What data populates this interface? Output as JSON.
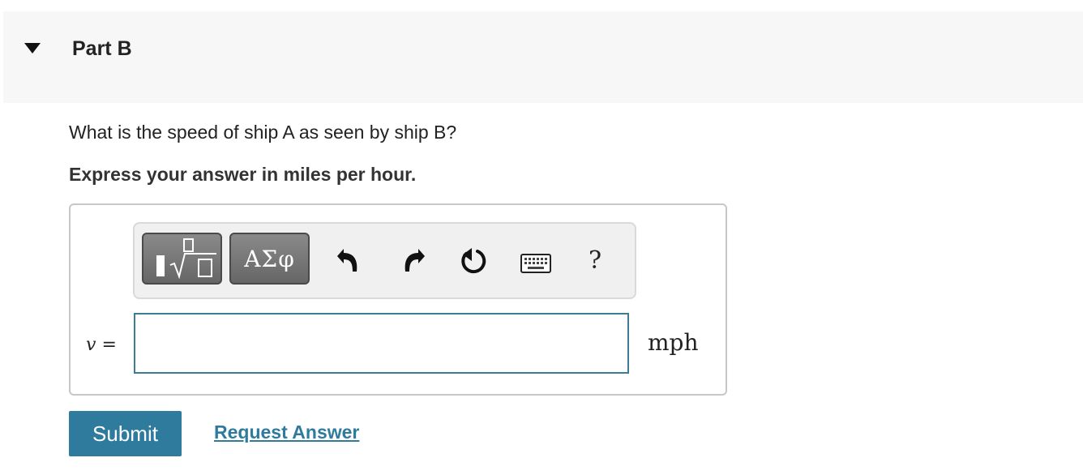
{
  "part": {
    "title": "Part B"
  },
  "question": {
    "text": "What is the speed of ship A as seen by ship B?",
    "instruction": "Express your answer in miles per hour."
  },
  "toolbar": {
    "templates_icon": "templates-sqrt-icon",
    "symbols_label": "ΑΣφ",
    "undo_icon": "undo-icon",
    "redo_icon": "redo-icon",
    "reset_icon": "reset-icon",
    "keyboard_icon": "keyboard-icon",
    "help_label": "?"
  },
  "answer": {
    "variable": "v",
    "equals": "=",
    "value": "",
    "unit": "mph"
  },
  "actions": {
    "submit_label": "Submit",
    "request_label": "Request Answer"
  },
  "colors": {
    "accent": "#2f7b9e",
    "input_border": "#3b7d94",
    "header_bg": "#f7f7f7"
  }
}
